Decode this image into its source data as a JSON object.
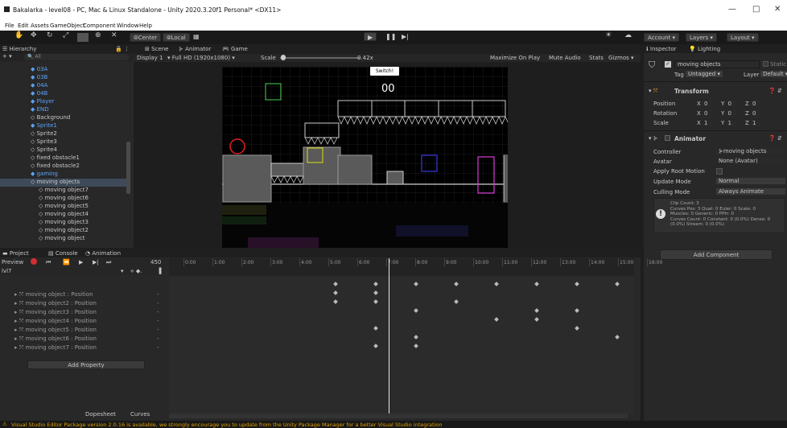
{
  "window": {
    "title": "Bakalarka - level08 - PC, Mac & Linux Standalone - Unity 2020.3.20f1 Personal* <DX11>",
    "minimize": "—",
    "maximize": "□",
    "close": "✕"
  },
  "menu": [
    "File",
    "Edit",
    "Assets",
    "GameObject",
    "Component",
    "Window",
    "Help"
  ],
  "toolbar": {
    "pivot": "Center",
    "space": "Local",
    "account": "Account",
    "layers": "Layers",
    "layout": "Layout"
  },
  "hierarchy": {
    "tab": "Hierarchy",
    "search_placeholder": "All",
    "items": [
      {
        "label": "03A",
        "icon": "prefab"
      },
      {
        "label": "03B",
        "icon": "prefab"
      },
      {
        "label": "04A",
        "icon": "prefab"
      },
      {
        "label": "04B",
        "icon": "prefab"
      },
      {
        "label": "Player",
        "icon": "prefab"
      },
      {
        "label": "END",
        "icon": "prefab"
      },
      {
        "label": "Background",
        "icon": "object"
      },
      {
        "label": "Sprite1",
        "icon": "prefab"
      },
      {
        "label": "Sprite2",
        "icon": "object"
      },
      {
        "label": "Sprite3",
        "icon": "object"
      },
      {
        "label": "Sprite4",
        "icon": "object"
      },
      {
        "label": "fixed obstacle1",
        "icon": "object"
      },
      {
        "label": "fixed obstacle2",
        "icon": "object"
      },
      {
        "label": "gaming",
        "icon": "prefab"
      },
      {
        "label": "moving objects",
        "icon": "object"
      },
      {
        "label": "moving object7",
        "icon": "object"
      },
      {
        "label": "moving object6",
        "icon": "object"
      },
      {
        "label": "moving object5",
        "icon": "object"
      },
      {
        "label": "moving object4",
        "icon": "object"
      },
      {
        "label": "moving object3",
        "icon": "object"
      },
      {
        "label": "moving object2",
        "icon": "object"
      },
      {
        "label": "moving object",
        "icon": "object"
      }
    ]
  },
  "center_tabs": {
    "scene": "Scene",
    "animator": "Animator",
    "game": "Game"
  },
  "game_bar": {
    "display": "Display 1",
    "resolution": "Full HD (1920x1080)",
    "scale_label": "Scale",
    "scale_value": "0.42x",
    "maximize": "Maximize On Play",
    "mute": "Mute Audio",
    "stats": "Stats",
    "gizmos": "Gizmos"
  },
  "game": {
    "switch_label": "Switch!",
    "score": "00"
  },
  "inspector": {
    "tab": "Inspector",
    "lighting": "Lighting",
    "object_name": "moving objects",
    "static": "Static",
    "tag_label": "Tag",
    "tag": "Untagged",
    "layer_label": "Layer",
    "layer": "Default",
    "transform": {
      "title": "Transform",
      "position": "Position",
      "rotation": "Rotation",
      "scale": "Scale",
      "pos": [
        "0",
        "0",
        "0"
      ],
      "rot": [
        "0",
        "0",
        "0"
      ],
      "scl": [
        "1",
        "1",
        "1"
      ]
    },
    "animator": {
      "title": "Animator",
      "controller_label": "Controller",
      "controller": "moving objects",
      "avatar_label": "Avatar",
      "avatar": "None (Avatar)",
      "root_motion": "Apply Root Motion",
      "update_label": "Update Mode",
      "update": "Normal",
      "culling_label": "Culling Mode",
      "culling": "Always Animate",
      "info": [
        "Clip Count: 3",
        "Curves Pos: 3 Quat: 0 Euler: 0 Scale: 0",
        "Muscles: 0 Generic: 0 PPtr: 0",
        "Curves Count: 0 Constant: 0 (0.0%) Dense: 0",
        "(0.0%) Stream: 0 (0.0%)"
      ]
    },
    "add_component": "Add Component"
  },
  "bottom_tabs": {
    "project": "Project",
    "console": "Console",
    "animation": "Animation"
  },
  "animation": {
    "preview": "Preview",
    "frame": "450",
    "clip": "lvl7",
    "add_property": "Add Property",
    "dopesheet": "Dopesheet",
    "curves": "Curves",
    "ticks": [
      "0:00",
      "1:00",
      "2:00",
      "3:00",
      "4:00",
      "5:00",
      "6:00",
      "7:00",
      "8:00",
      "9:00",
      "10:00",
      "11:00",
      "12:00",
      "13:00",
      "14:00",
      "15:00",
      "16:00"
    ],
    "rows": [
      "moving object : Position",
      "moving object2 : Position",
      "moving object3 : Position",
      "moving object4 : Position",
      "moving object5 : Position",
      "moving object6 : Position",
      "moving object7 : Position"
    ]
  },
  "status": "Visual Studio Editor Package version 2.0.16 is available, we strongly encourage you to update from the Unity Package Manager for a better Visual Studio integration"
}
